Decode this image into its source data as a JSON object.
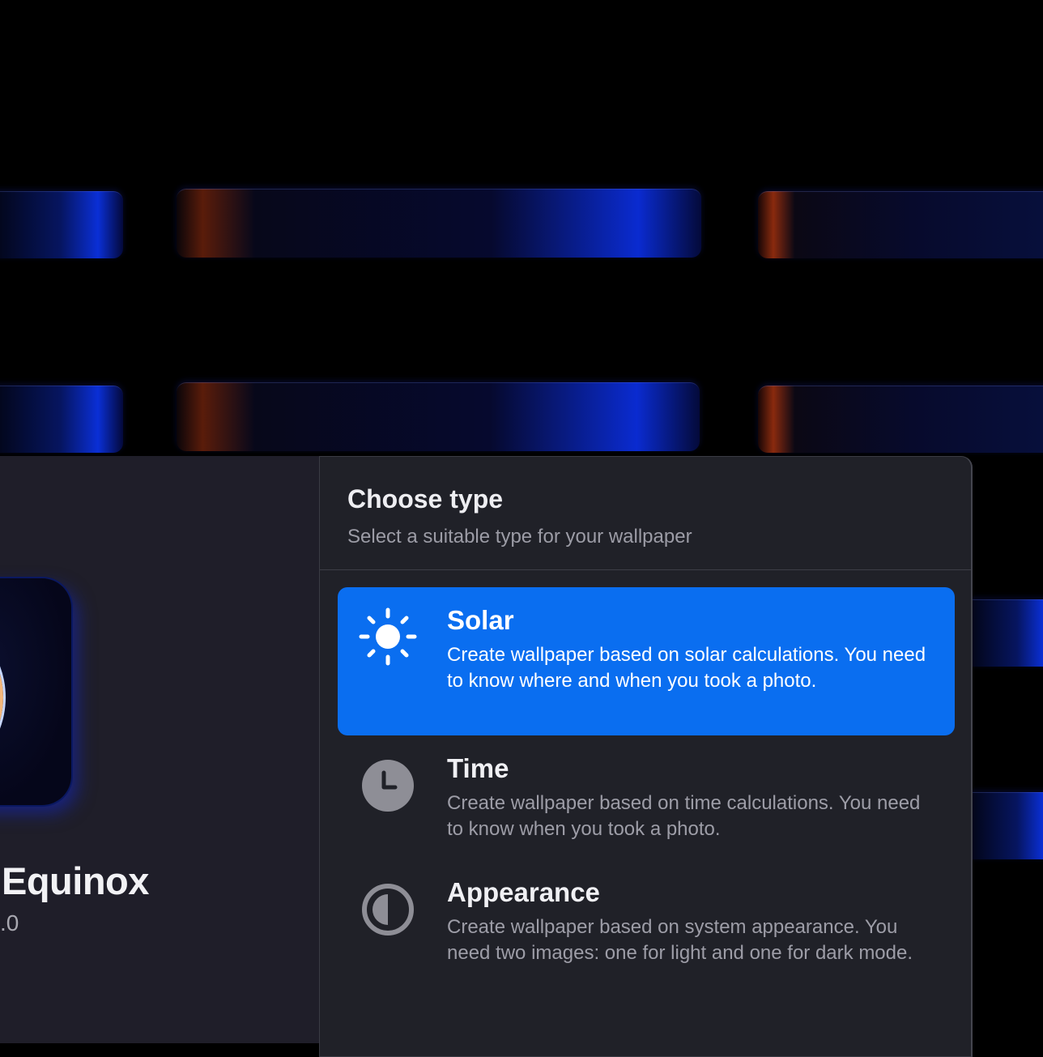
{
  "app": {
    "name": "Equinox",
    "version": ".0"
  },
  "dialog": {
    "title": "Choose type",
    "subtitle": "Select a suitable type for your wallpaper"
  },
  "options": [
    {
      "title": "Solar",
      "description": "Create wallpaper based on solar calculations. You need to know where and when you took a photo.",
      "icon": "sun-icon",
      "selected": true
    },
    {
      "title": "Time",
      "description": "Create wallpaper based on time calculations. You need to know when you took a photo.",
      "icon": "clock-icon",
      "selected": false
    },
    {
      "title": "Appearance",
      "description": "Create wallpaper based on system appearance. You need two images: one for light and one for dark mode.",
      "icon": "half-circle-icon",
      "selected": false
    }
  ],
  "colors": {
    "accent": "#0a6ef0",
    "sheet_background": "#202128",
    "background": "#000000"
  }
}
